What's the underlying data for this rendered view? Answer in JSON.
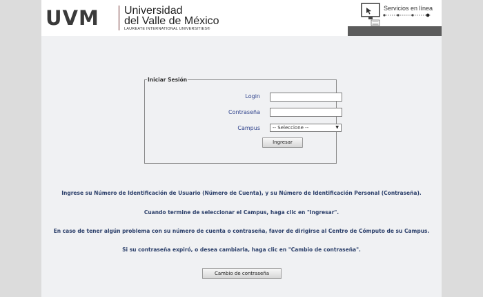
{
  "header": {
    "logo_mark": "UVM",
    "logo_line1": "Universidad",
    "logo_line2": "del Valle de México",
    "logo_tagline": "LAUREATE INTERNATIONAL UNIVERSITIES®",
    "services_title": "Servicios en línea"
  },
  "login": {
    "legend": "Iniciar Sesión",
    "login_label": "Login",
    "login_value": "",
    "password_label": "Contraseña",
    "password_value": "",
    "campus_label": "Campus",
    "campus_selected": "-- Seleccione --",
    "submit_label": "Ingresar"
  },
  "info": {
    "line1": "Ingrese su Número de Identificación de Usuario (Número de Cuenta), y su Número de Identificación Personal (Contraseña).",
    "line2": "Cuando termine de seleccionar el Campus, haga clic en \"Ingresar\".",
    "line3": "En caso de tener algún problema con su número de cuenta o contraseña, favor de dirigirse al Centro de Cómputo de su Campus.",
    "line4": "Si su contraseña expiró, o desea cambiarla, haga clic en \"Cambio de contraseña\"."
  },
  "change_password_label": "Cambio de contraseña",
  "colors": {
    "label_blue": "#2b3f8a",
    "info_text": "#2b3f6a",
    "page_bg": "#f0f1f3",
    "header_bar": "#5c5c5c"
  }
}
